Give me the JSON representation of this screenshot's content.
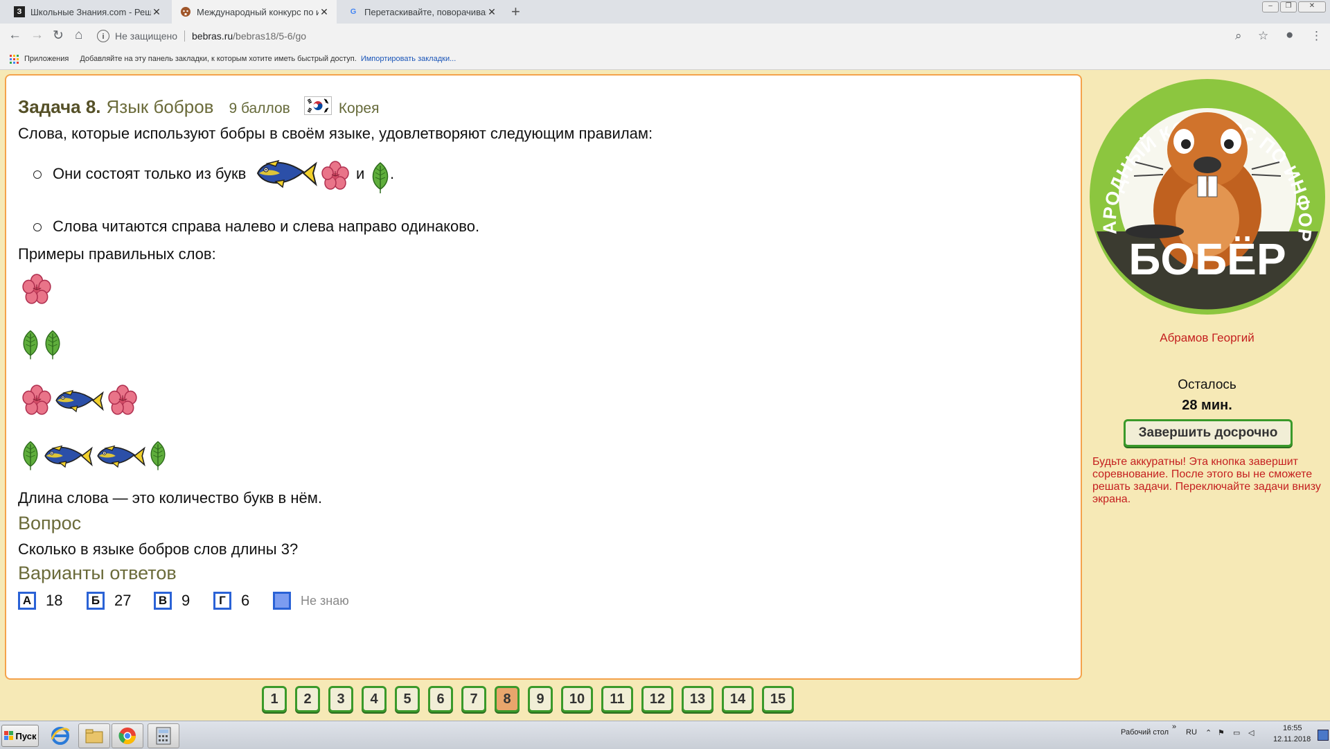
{
  "browser": {
    "tabs": [
      {
        "label": "Школьные Знания.com - Решаем д",
        "favicon": "З",
        "active": false
      },
      {
        "label": "Международный конкурс по инфо",
        "favicon": "beaver",
        "active": true
      },
      {
        "label": "Перетаскивайте, поворачивайте и",
        "favicon": "G",
        "active": false
      }
    ],
    "new_tab": "+",
    "security": "Не защищено",
    "url_domain": "bebras.ru",
    "url_path": "/bebras18/5-6/go",
    "bookmarks_apps": "Приложения",
    "bookmarks_hint": "Добавляйте на эту панель закладки, к которым хотите иметь быстрый доступ.",
    "bookmarks_import": "Импортировать закладки..."
  },
  "task": {
    "number": "Задача 8.",
    "name": "Язык бобров",
    "points": "9 баллов",
    "country": "Корея",
    "intro": "Слова, которые используют бобры в своём языке, удовлетворяют следующим правилам:",
    "rule1_prefix": "Они состоят только из букв",
    "rule1_and": "и",
    "rule1_end": ".",
    "rule2": "Слова читаются справа налево и слева направо одинаково.",
    "examples_title": "Примеры правильных слов:",
    "examples": [
      [
        "flower"
      ],
      [
        "leaf",
        "leaf"
      ],
      [
        "flower",
        "fish",
        "flower"
      ],
      [
        "leaf",
        "fish",
        "fish",
        "leaf"
      ]
    ],
    "length_def": "Длина слова — это количество букв в нём.",
    "question_title": "Вопрос",
    "question": "Сколько в языке бобров слов длины 3?",
    "answers_title": "Варианты ответов",
    "answers": [
      {
        "letter": "А",
        "value": "18"
      },
      {
        "letter": "Б",
        "value": "27"
      },
      {
        "letter": "В",
        "value": "9"
      },
      {
        "letter": "Г",
        "value": "6"
      }
    ],
    "dont_know": "Не знаю"
  },
  "sidebar": {
    "logo_arc": "МЕЖДУНАРОДНЫЙ КОНКУРС ПО ИНФОРМАТИКЕ",
    "logo_title": "БОБЁР",
    "user": "Абрамов Георгий",
    "remaining_label": "Осталось",
    "remaining_value": "28 мин.",
    "finish_button": "Завершить досрочно",
    "warning": "Будьте аккуратны! Эта кнопка завершит соревнование. После этого вы не сможете решать задачи. Переключайте задачи внизу экрана."
  },
  "pager": {
    "pages": [
      "1",
      "2",
      "3",
      "4",
      "5",
      "6",
      "7",
      "8",
      "9",
      "10",
      "11",
      "12",
      "13",
      "14",
      "15"
    ],
    "current": "8"
  },
  "taskbar": {
    "start": "Пуск",
    "desktop": "Рабочий стол",
    "lang": "RU",
    "time": "16:55",
    "date": "12.11.2018"
  },
  "colors": {
    "accent_orange": "#f4a24b",
    "button_green": "#3a9a2a",
    "answer_blue": "#2a62d6",
    "warning_red": "#c41f1f",
    "page_bg": "#f6e9b6"
  }
}
